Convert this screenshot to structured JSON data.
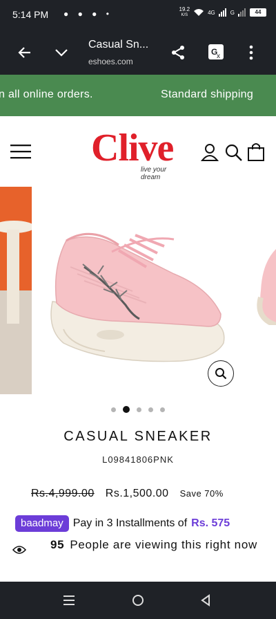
{
  "status_bar": {
    "time": "5:14 PM",
    "notification_icons": "● ● ● •",
    "net_speed": "19.2",
    "net_unit": "K/S",
    "network_1": "4G",
    "network_2": "G",
    "battery": "44"
  },
  "browser": {
    "tab_title": "Casual Sn...",
    "url": "eshoes.com"
  },
  "announcement": {
    "left_text": "n all online orders.",
    "right_text": "Standard shipping"
  },
  "brand": {
    "name": "Clive",
    "tagline": "live your dream",
    "color": "#e0202a"
  },
  "carousel": {
    "slide_count": 5,
    "active_index": 1
  },
  "product": {
    "title": "CASUAL SNEAKER",
    "sku": "L09841806PNK",
    "old_price": "Rs.4,999.00",
    "new_price": "Rs.1,500.00",
    "save_text": "Save 70%"
  },
  "baadmay": {
    "badge": "baadmay",
    "text": "Pay in 3 Installments of",
    "amount": "Rs. 575",
    "color": "#6c3dd8"
  },
  "viewers": {
    "count": "95",
    "text": "People are viewing this right now"
  },
  "colors": {
    "announcement_bg": "#4a8a50",
    "system_bar_bg": "#1f2227"
  }
}
